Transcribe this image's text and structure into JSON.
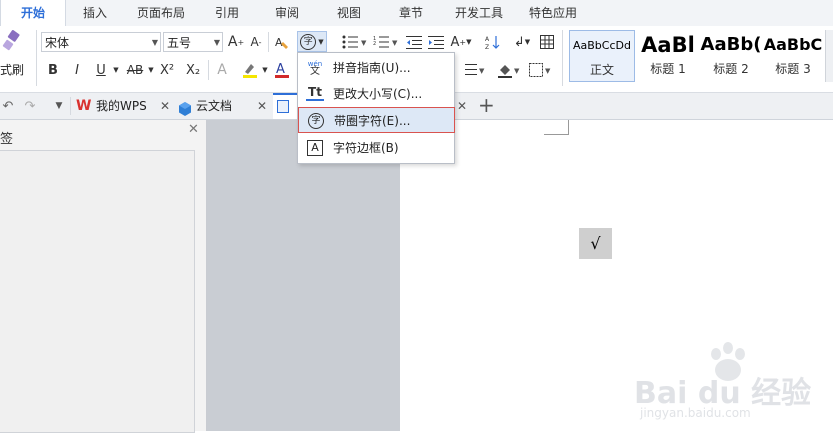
{
  "menu_tabs": [
    "开始",
    "插入",
    "页面布局",
    "引用",
    "审阅",
    "视图",
    "章节",
    "开发工具",
    "特色应用"
  ],
  "ribbon": {
    "format_painter_label": "式刷",
    "font_name": "宋体",
    "font_size": "五号",
    "bold": "B",
    "italic": "I",
    "underline": "U",
    "strikethrough": "AB",
    "superscript": "X²",
    "subscript": "X₂",
    "enclose_char_glyph": "字",
    "styles": [
      {
        "sample": "AaBbCcDd",
        "label": "正文"
      },
      {
        "sample": "AaBl",
        "label": "标题 1"
      },
      {
        "sample": "AaBb(",
        "label": "标题 2"
      },
      {
        "sample": "AaBbC",
        "label": "标题 3"
      }
    ]
  },
  "doc_tabs": {
    "my_wps": "我的WPS",
    "cloud_docs": "云文档",
    "new_tab": "+"
  },
  "left_pane": {
    "title_fragment": "签"
  },
  "dropdown": {
    "items": [
      {
        "label": "拼音指南(U)...",
        "icon": "pinyin-icon",
        "highlighted": false
      },
      {
        "label": "更改大小写(C)...",
        "icon": "change-case-icon",
        "highlighted": false
      },
      {
        "label": "带圈字符(E)...",
        "icon": "enclosed-character-icon",
        "highlighted": true
      },
      {
        "label": "字符边框(B)",
        "icon": "character-border-icon",
        "highlighted": false
      }
    ],
    "pinyin_top": "wén",
    "pinyin_char": "文",
    "case_glyph": "Tt",
    "enclosed_glyph": "字",
    "border_glyph": "A"
  },
  "document": {
    "selected_text": "√"
  },
  "watermark": {
    "brand": "Bai du 经验",
    "url": "jingyan.baidu.com"
  },
  "colors": {
    "accent": "#2e6fd8",
    "highlight_box": "#d9534f",
    "menu_hover": "#dde8f6",
    "font_color_bar": "#d22a2a",
    "highlight_color_bar": "#f5e600",
    "wps_logo": "#d9312f",
    "cloud_logo": "#2f7fd6"
  }
}
